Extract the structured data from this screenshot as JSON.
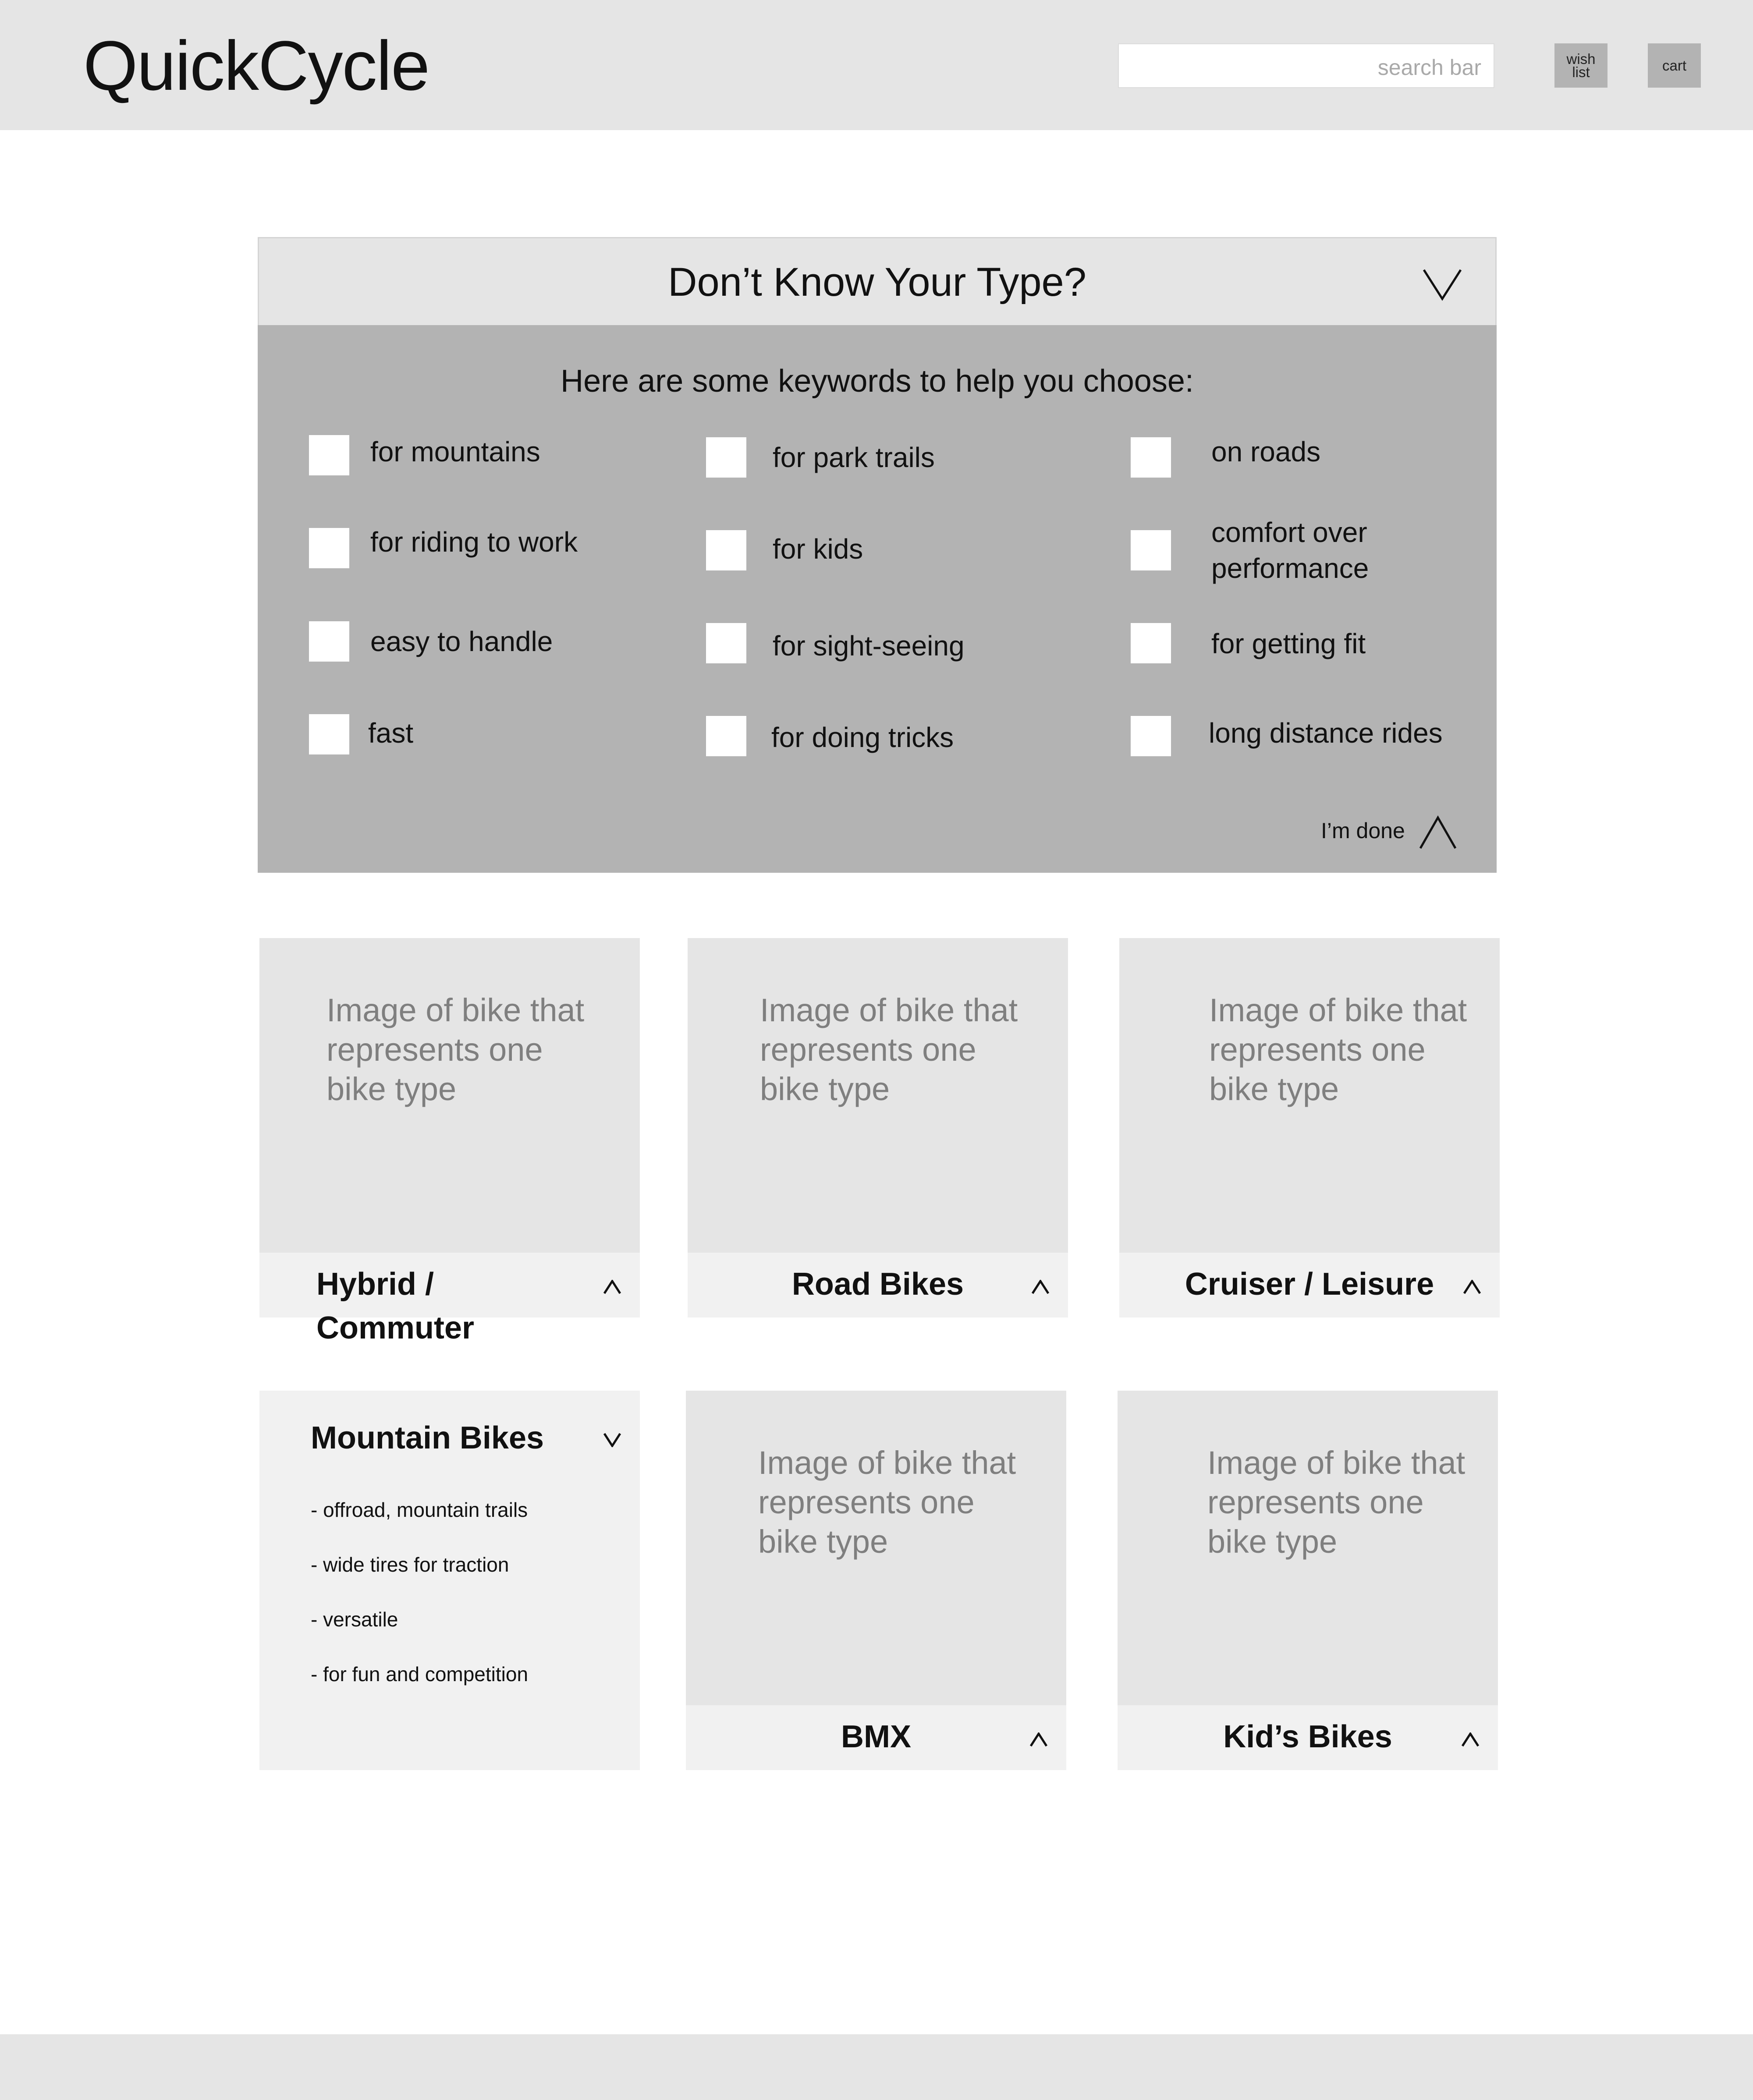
{
  "header": {
    "logo": "QuickCycle",
    "search_placeholder": "search bar",
    "wishlist_label": "wish list",
    "cart_label": "cart"
  },
  "quiz": {
    "title": "Don’t Know Your Type?",
    "subtitle": "Here are some keywords to help you choose:",
    "keywords": [
      "for mountains",
      "for park trails",
      "on roads",
      "for riding to work",
      "for kids",
      "comfort over performance",
      "easy to handle",
      "for sight-seeing",
      "for getting fit",
      "fast",
      "for doing tricks",
      "long distance rides"
    ],
    "done_label": "I’m done"
  },
  "cards": [
    {
      "name": "Hybrid / Commuter",
      "image_text": "Image of bike that represents one bike type"
    },
    {
      "name": "Road Bikes",
      "image_text": "Image of bike that represents one bike type"
    },
    {
      "name": "Cruiser / Leisure",
      "image_text": "Image of bike that represents one bike type"
    },
    {
      "name": "Mountain Bikes",
      "details": [
        "- offroad, mountain trails",
        "- wide tires for traction",
        "- versatile",
        "- for fun and competition"
      ]
    },
    {
      "name": "BMX",
      "image_text": "Image of bike that represents one bike type"
    },
    {
      "name": "Kid’s Bikes",
      "image_text": "Image of bike that represents one bike type"
    }
  ],
  "icons": {
    "quiz_toggle": "chevron-down-icon",
    "done": "chevron-up-icon",
    "card_expand": "chevron-up-icon",
    "card_collapse": "chevron-down-icon"
  }
}
